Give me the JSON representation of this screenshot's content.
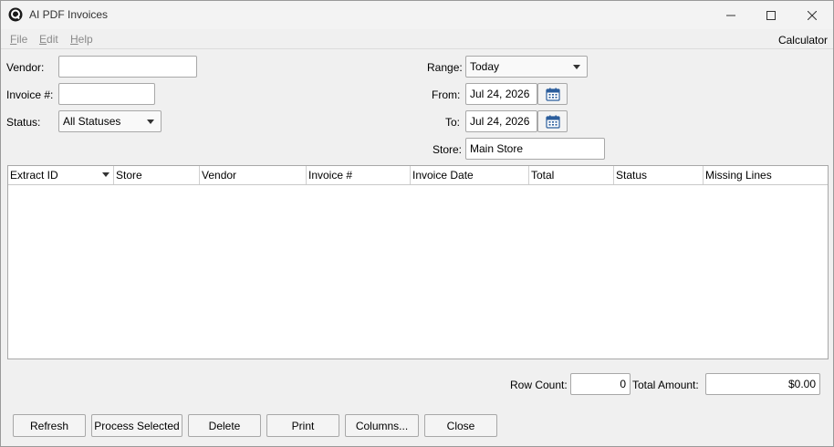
{
  "window": {
    "title": "AI PDF Invoices",
    "app_icon": "q-logo-icon"
  },
  "menu": {
    "file": {
      "u": "F",
      "rest": "ile"
    },
    "edit": {
      "u": "E",
      "rest": "dit"
    },
    "help": {
      "u": "H",
      "rest": "elp"
    },
    "calculator": "Calculator"
  },
  "filters": {
    "vendor_label": "Vendor:",
    "vendor_value": "",
    "invoice_label": "Invoice #:",
    "invoice_value": "",
    "status_label": "Status:",
    "status_value": "All Statuses",
    "range_label": "Range:",
    "range_value": "Today",
    "from_label": "From:",
    "from_value": "Jul 24, 2026",
    "to_label": "To:",
    "to_value": "Jul 24, 2026",
    "store_label": "Store:",
    "store_value": "Main Store"
  },
  "table": {
    "columns": [
      "Extract ID",
      "Store",
      "Vendor",
      "Invoice #",
      "Invoice Date",
      "Total",
      "Status",
      "Missing Lines"
    ],
    "rows": []
  },
  "summary": {
    "row_count_label": "Row Count:",
    "row_count_value": "0",
    "total_amount_label": "Total Amount:",
    "total_amount_value": "$0.00"
  },
  "buttons": {
    "refresh": "Refresh",
    "process_selected": "Process Selected",
    "delete": "Delete",
    "print": "Print",
    "columns": "Columns...",
    "close": "Close"
  }
}
